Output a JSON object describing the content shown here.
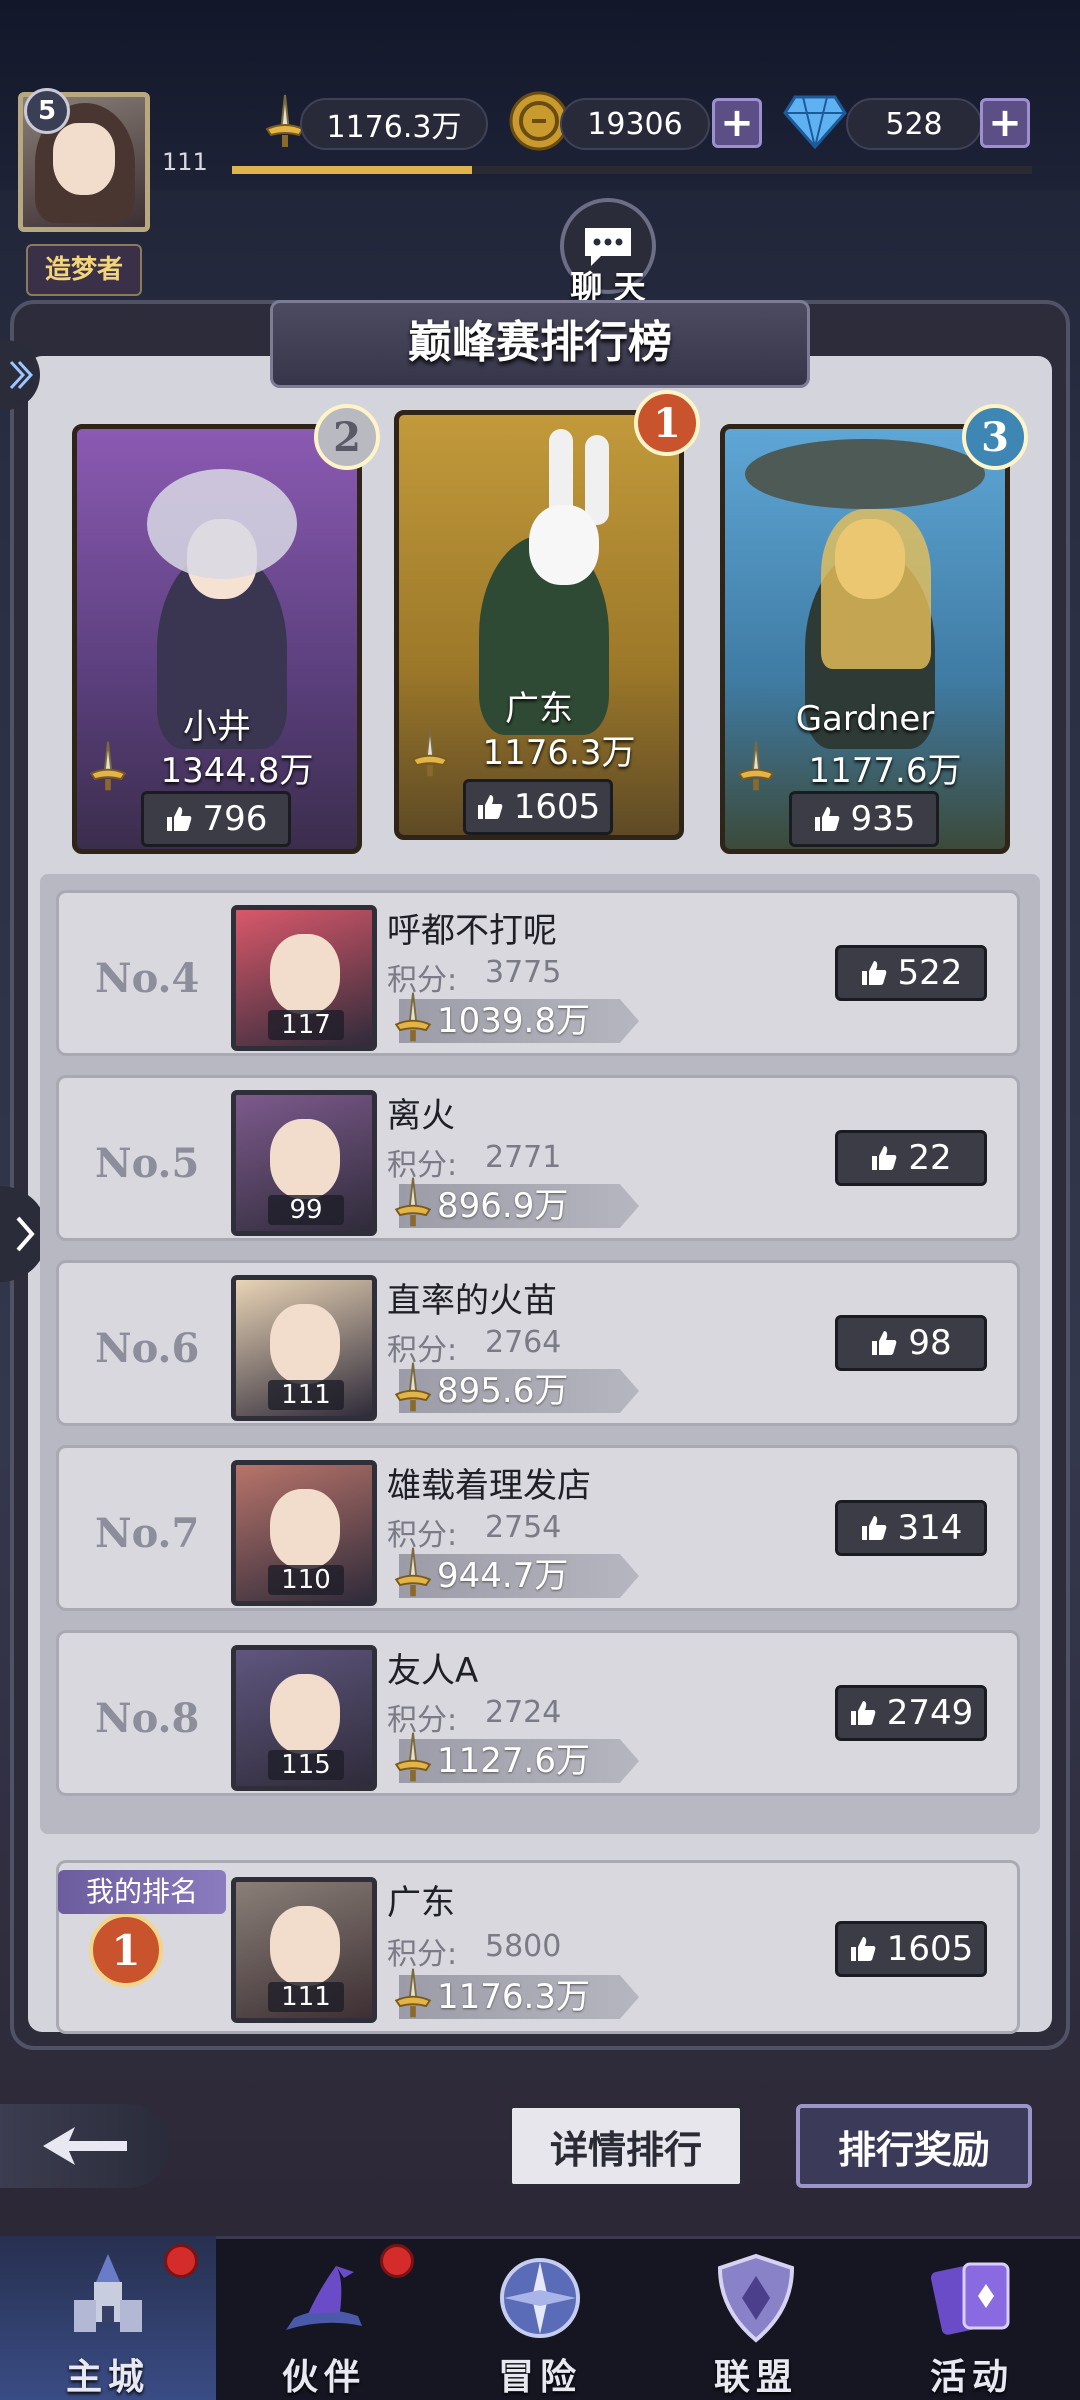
{
  "player": {
    "level": "5",
    "exp_value": "111",
    "exp_progress": 0.3,
    "title": "造梦者"
  },
  "resources": {
    "power": "1176.3万",
    "gold": "19306",
    "diamond": "528"
  },
  "chat": {
    "label": "聊 天"
  },
  "panel": {
    "title": "巅峰赛排行榜"
  },
  "top3": [
    {
      "rank": "2",
      "name": "小井",
      "power": "1344.8万",
      "likes": "796",
      "medal_color": "#b9b9c2"
    },
    {
      "rank": "1",
      "name": "广东",
      "power": "1176.3万",
      "likes": "1605",
      "medal_color": "#c9532c"
    },
    {
      "rank": "3",
      "name": "Gardner",
      "power": "1177.6万",
      "likes": "935",
      "medal_color": "#3e86b3"
    }
  ],
  "ranking": {
    "score_label": "积分:",
    "rows": [
      {
        "no": "No.4",
        "name": "呼都不打呢",
        "score": "3775",
        "power": "1039.8万",
        "likes": "522",
        "level": "117",
        "avatar_color": "#d9586a"
      },
      {
        "no": "No.5",
        "name": "离火",
        "score": "2771",
        "power": "896.9万",
        "likes": "22",
        "level": "99",
        "avatar_color": "#7d5a8c"
      },
      {
        "no": "No.6",
        "name": "直率的火苗",
        "score": "2764",
        "power": "895.6万",
        "likes": "98",
        "level": "111",
        "avatar_color": "#e8d3b5"
      },
      {
        "no": "No.7",
        "name": "雄载着理发店",
        "score": "2754",
        "power": "944.7万",
        "likes": "314",
        "level": "110",
        "avatar_color": "#b8746a"
      },
      {
        "no": "No.8",
        "name": "友人A",
        "score": "2724",
        "power": "1127.6万",
        "likes": "2749",
        "level": "115",
        "avatar_color": "#5f567e"
      }
    ]
  },
  "my_rank": {
    "tag": "我的排名",
    "rank": "1",
    "name": "广东",
    "score": "5800",
    "power": "1176.3万",
    "likes": "1605",
    "level": "111"
  },
  "buttons": {
    "detail": "详情排行",
    "reward": "排行奖励"
  },
  "nav": [
    {
      "label": "主城",
      "icon": "castle-icon",
      "active": true
    },
    {
      "label": "伙伴",
      "icon": "witch-hat-icon",
      "active": false
    },
    {
      "label": "冒险",
      "icon": "compass-icon",
      "active": false
    },
    {
      "label": "联盟",
      "icon": "shield-icon",
      "active": false
    },
    {
      "label": "活动",
      "icon": "cards-icon",
      "active": false
    }
  ]
}
